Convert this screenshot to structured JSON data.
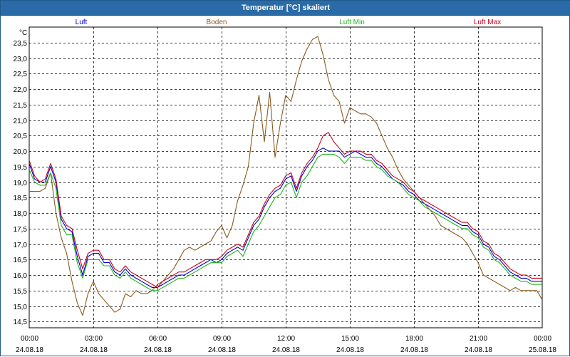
{
  "window": {
    "title": "Temperatur [°C] skaliert"
  },
  "chart_data": {
    "type": "line",
    "title": "Temperatur [°C] skaliert",
    "ylabel": "°C",
    "xlabel": "",
    "ylim": [
      14.3,
      24.0
    ],
    "xlim": [
      0,
      24
    ],
    "grid": true,
    "legend_position": "top",
    "y_ticks": [
      14.5,
      15.0,
      15.5,
      16.0,
      16.5,
      17.0,
      17.5,
      18.0,
      18.5,
      19.0,
      19.5,
      20.0,
      20.5,
      21.0,
      21.5,
      22.0,
      22.5,
      23.0,
      23.5
    ],
    "y_tick_labels": [
      "14,5",
      "15,0",
      "15,5",
      "16,0",
      "16,5",
      "17,0",
      "17,5",
      "18,0",
      "18,5",
      "19,0",
      "19,5",
      "20,0",
      "20,5",
      "21,0",
      "21,5",
      "22,0",
      "22,5",
      "23,0",
      "23,5"
    ],
    "x_ticks": [
      0,
      3,
      6,
      9,
      12,
      15,
      18,
      21,
      24
    ],
    "x_tick_labels": [
      {
        "time": "00:00",
        "date": "24.08.18"
      },
      {
        "time": "03:00",
        "date": "24.08.18"
      },
      {
        "time": "06:00",
        "date": "24.08.18"
      },
      {
        "time": "09:00",
        "date": "24.08.18"
      },
      {
        "time": "12:00",
        "date": "24.08.18"
      },
      {
        "time": "15:00",
        "date": "24.08.18"
      },
      {
        "time": "18:00",
        "date": "24.08.18"
      },
      {
        "time": "21:00",
        "date": "24.08.18"
      },
      {
        "time": "00:00",
        "date": "25.08.18"
      }
    ],
    "series": [
      {
        "name": "Luft",
        "color": "#0000c8",
        "x": [
          0,
          0.25,
          0.5,
          0.75,
          1,
          1.25,
          1.5,
          1.75,
          2,
          2.25,
          2.5,
          2.75,
          3,
          3.25,
          3.5,
          3.75,
          4,
          4.25,
          4.5,
          4.75,
          5,
          5.25,
          5.5,
          5.75,
          6,
          6.25,
          6.5,
          6.75,
          7,
          7.25,
          7.5,
          7.75,
          8,
          8.25,
          8.5,
          8.75,
          9,
          9.25,
          9.5,
          9.75,
          10,
          10.25,
          10.5,
          10.75,
          11,
          11.25,
          11.5,
          11.75,
          12,
          12.25,
          12.5,
          12.75,
          13,
          13.25,
          13.5,
          13.75,
          14,
          14.25,
          14.5,
          14.75,
          15,
          15.25,
          15.5,
          15.75,
          16,
          16.25,
          16.5,
          16.75,
          17,
          17.25,
          17.5,
          17.75,
          18,
          18.25,
          18.5,
          18.75,
          19,
          19.25,
          19.5,
          19.75,
          20,
          20.25,
          20.5,
          20.75,
          21,
          21.25,
          21.5,
          21.75,
          22,
          22.25,
          22.5,
          22.75,
          23,
          23.25,
          23.5,
          23.75,
          24
        ],
        "values": [
          19.6,
          19.1,
          19.0,
          19.0,
          19.5,
          19.0,
          17.8,
          17.5,
          17.4,
          16.6,
          16.0,
          16.6,
          16.7,
          16.7,
          16.4,
          16.4,
          16.1,
          16.0,
          16.2,
          16.0,
          15.9,
          15.8,
          15.7,
          15.6,
          15.6,
          15.7,
          15.8,
          15.9,
          16.0,
          16.0,
          16.1,
          16.2,
          16.3,
          16.4,
          16.5,
          16.4,
          16.5,
          16.7,
          16.8,
          16.9,
          16.8,
          17.2,
          17.6,
          17.8,
          18.2,
          18.5,
          18.7,
          18.8,
          19.1,
          19.2,
          18.7,
          19.2,
          19.5,
          19.7,
          20.0,
          20.1,
          20.0,
          20.0,
          20.0,
          19.8,
          19.9,
          20.0,
          19.9,
          19.8,
          19.8,
          19.6,
          19.5,
          19.3,
          19.1,
          19.0,
          18.9,
          18.7,
          18.6,
          18.4,
          18.3,
          18.2,
          18.1,
          18.0,
          17.9,
          17.8,
          17.7,
          17.6,
          17.6,
          17.4,
          17.3,
          17.0,
          16.9,
          16.6,
          16.5,
          16.3,
          16.1,
          16.0,
          15.9,
          15.9,
          15.8,
          15.8,
          15.8
        ]
      },
      {
        "name": "Boden",
        "color": "#8b5a1e",
        "x": [
          0,
          0.25,
          0.5,
          0.75,
          1,
          1.25,
          1.5,
          1.75,
          2,
          2.25,
          2.5,
          2.75,
          3,
          3.25,
          3.5,
          3.75,
          4,
          4.25,
          4.5,
          4.75,
          5,
          5.25,
          5.5,
          5.75,
          6,
          6.25,
          6.5,
          6.75,
          7,
          7.25,
          7.5,
          7.75,
          8,
          8.25,
          8.5,
          8.75,
          9,
          9.25,
          9.5,
          9.75,
          10,
          10.25,
          10.5,
          10.75,
          11,
          11.25,
          11.5,
          11.75,
          12,
          12.25,
          12.5,
          12.75,
          13,
          13.25,
          13.5,
          13.75,
          14,
          14.25,
          14.5,
          14.75,
          15,
          15.25,
          15.5,
          15.75,
          16,
          16.25,
          16.5,
          16.75,
          17,
          17.25,
          17.5,
          17.75,
          18,
          18.25,
          18.5,
          18.75,
          19,
          19.25,
          19.5,
          19.75,
          20,
          20.25,
          20.5,
          20.75,
          21,
          21.25,
          21.5,
          21.75,
          22,
          22.25,
          22.5,
          22.75,
          23,
          23.25,
          23.5,
          23.75,
          24
        ],
        "values": [
          18.7,
          18.7,
          18.7,
          18.8,
          19.3,
          18.0,
          17.2,
          16.7,
          15.8,
          15.1,
          14.7,
          15.4,
          15.8,
          15.4,
          15.2,
          15.0,
          14.8,
          14.9,
          15.4,
          15.3,
          15.5,
          15.4,
          15.4,
          15.5,
          15.7,
          15.8,
          16.0,
          16.2,
          16.5,
          16.8,
          16.9,
          16.8,
          16.9,
          17.0,
          17.1,
          17.4,
          17.6,
          17.2,
          17.6,
          18.4,
          18.9,
          19.5,
          20.9,
          21.8,
          20.3,
          21.9,
          19.8,
          20.9,
          21.8,
          21.6,
          22.3,
          22.9,
          23.3,
          23.6,
          23.7,
          23.1,
          22.3,
          21.8,
          21.6,
          20.9,
          21.4,
          21.3,
          21.2,
          21.2,
          21.1,
          20.9,
          20.5,
          20.1,
          19.8,
          19.4,
          19.1,
          18.9,
          18.7,
          18.5,
          18.3,
          18.1,
          17.9,
          17.6,
          17.5,
          17.4,
          17.3,
          17.2,
          17.0,
          16.7,
          16.4,
          16.0,
          15.9,
          15.8,
          15.7,
          15.6,
          15.5,
          15.6,
          15.5,
          15.5,
          15.5,
          15.5,
          15.2
        ]
      },
      {
        "name": "Luft Min",
        "color": "#1fb41f",
        "x": [
          0,
          0.25,
          0.5,
          0.75,
          1,
          1.25,
          1.5,
          1.75,
          2,
          2.25,
          2.5,
          2.75,
          3,
          3.25,
          3.5,
          3.75,
          4,
          4.25,
          4.5,
          4.75,
          5,
          5.25,
          5.5,
          5.75,
          6,
          6.25,
          6.5,
          6.75,
          7,
          7.25,
          7.5,
          7.75,
          8,
          8.25,
          8.5,
          8.75,
          9,
          9.25,
          9.5,
          9.75,
          10,
          10.25,
          10.5,
          10.75,
          11,
          11.25,
          11.5,
          11.75,
          12,
          12.25,
          12.5,
          12.75,
          13,
          13.25,
          13.5,
          13.75,
          14,
          14.25,
          14.5,
          14.75,
          15,
          15.25,
          15.5,
          15.75,
          16,
          16.25,
          16.5,
          16.75,
          17,
          17.25,
          17.5,
          17.75,
          18,
          18.25,
          18.5,
          18.75,
          19,
          19.25,
          19.5,
          19.75,
          20,
          20.25,
          20.5,
          20.75,
          21,
          21.25,
          21.5,
          21.75,
          22,
          22.25,
          22.5,
          22.75,
          23,
          23.25,
          23.5,
          23.75,
          24
        ],
        "values": [
          19.4,
          19.0,
          18.9,
          18.9,
          19.3,
          18.8,
          17.6,
          17.3,
          17.3,
          16.4,
          15.9,
          16.5,
          16.5,
          16.5,
          16.3,
          16.3,
          16.0,
          15.9,
          16.1,
          15.9,
          15.8,
          15.7,
          15.6,
          15.5,
          15.5,
          15.6,
          15.7,
          15.8,
          15.9,
          15.9,
          16.0,
          16.1,
          16.2,
          16.3,
          16.4,
          16.4,
          16.4,
          16.6,
          16.7,
          16.8,
          16.6,
          17.0,
          17.4,
          17.6,
          17.9,
          18.2,
          18.5,
          18.6,
          18.9,
          19.0,
          18.5,
          19.0,
          19.2,
          19.5,
          19.8,
          19.9,
          19.9,
          19.9,
          19.8,
          19.6,
          19.8,
          19.8,
          19.8,
          19.7,
          19.7,
          19.5,
          19.4,
          19.2,
          19.1,
          19.0,
          18.8,
          18.6,
          18.5,
          18.4,
          18.2,
          18.1,
          18.0,
          17.9,
          17.8,
          17.7,
          17.6,
          17.5,
          17.5,
          17.3,
          17.2,
          16.9,
          16.8,
          16.5,
          16.4,
          16.2,
          16.0,
          15.9,
          15.8,
          15.8,
          15.7,
          15.7,
          15.7
        ]
      },
      {
        "name": "Luft Max",
        "color": "#c8001e",
        "x": [
          0,
          0.25,
          0.5,
          0.75,
          1,
          1.25,
          1.5,
          1.75,
          2,
          2.25,
          2.5,
          2.75,
          3,
          3.25,
          3.5,
          3.75,
          4,
          4.25,
          4.5,
          4.75,
          5,
          5.25,
          5.5,
          5.75,
          6,
          6.25,
          6.5,
          6.75,
          7,
          7.25,
          7.5,
          7.75,
          8,
          8.25,
          8.5,
          8.75,
          9,
          9.25,
          9.5,
          9.75,
          10,
          10.25,
          10.5,
          10.75,
          11,
          11.25,
          11.5,
          11.75,
          12,
          12.25,
          12.5,
          12.75,
          13,
          13.25,
          13.5,
          13.75,
          14,
          14.25,
          14.5,
          14.75,
          15,
          15.25,
          15.5,
          15.75,
          16,
          16.25,
          16.5,
          16.75,
          17,
          17.25,
          17.5,
          17.75,
          18,
          18.25,
          18.5,
          18.75,
          19,
          19.25,
          19.5,
          19.75,
          20,
          20.25,
          20.5,
          20.75,
          21,
          21.25,
          21.5,
          21.75,
          22,
          22.25,
          22.5,
          22.75,
          23,
          23.25,
          23.5,
          23.75,
          24
        ],
        "values": [
          19.7,
          19.2,
          19.0,
          19.1,
          19.6,
          19.1,
          17.9,
          17.6,
          17.5,
          16.8,
          16.2,
          16.7,
          16.8,
          16.8,
          16.5,
          16.5,
          16.2,
          16.1,
          16.3,
          16.1,
          16.0,
          15.9,
          15.8,
          15.7,
          15.6,
          15.8,
          15.9,
          16.0,
          16.1,
          16.1,
          16.2,
          16.3,
          16.4,
          16.5,
          16.5,
          16.5,
          16.6,
          16.8,
          16.9,
          17.0,
          16.9,
          17.3,
          17.7,
          17.9,
          18.3,
          18.6,
          18.8,
          18.9,
          19.2,
          19.3,
          18.8,
          19.3,
          19.6,
          19.8,
          20.1,
          20.5,
          20.6,
          20.3,
          20.1,
          19.9,
          20.0,
          20.0,
          20.0,
          19.9,
          19.9,
          19.7,
          19.6,
          19.4,
          19.2,
          19.1,
          19.0,
          18.8,
          18.7,
          18.5,
          18.4,
          18.3,
          18.2,
          18.1,
          18.0,
          17.9,
          17.8,
          17.7,
          17.7,
          17.5,
          17.4,
          17.1,
          17.0,
          16.7,
          16.6,
          16.4,
          16.2,
          16.1,
          16.0,
          16.0,
          15.9,
          15.9,
          15.9
        ]
      }
    ]
  }
}
